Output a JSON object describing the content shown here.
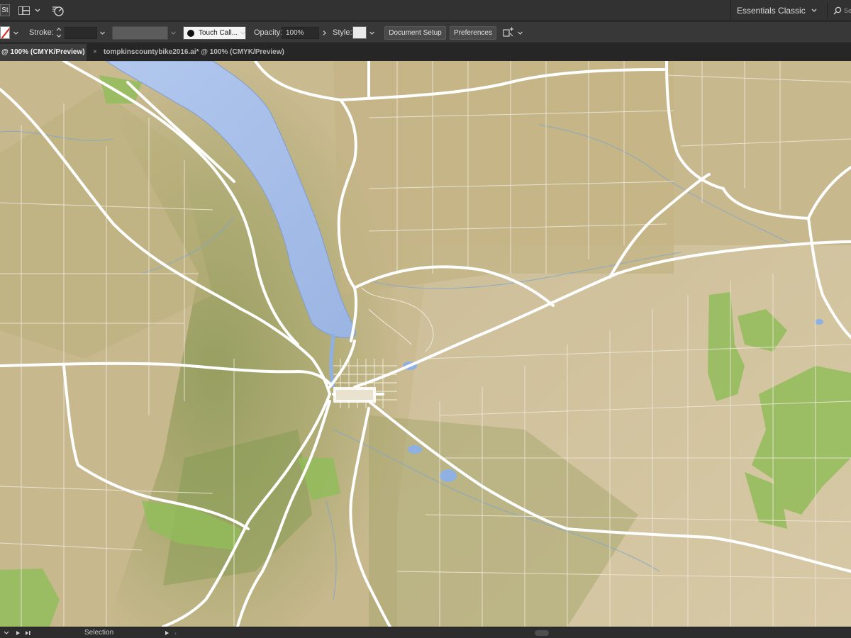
{
  "app": {
    "badge": "St",
    "workspace": "Essentials Classic",
    "search_hint": "Se"
  },
  "control_bar": {
    "stroke_label": "Stroke:",
    "stroke_value": "",
    "brush_label": "Touch Call...",
    "opacity_label": "Opacity:",
    "opacity_value": "100%",
    "style_label": "Style:",
    "document_setup_label": "Document Setup",
    "preferences_label": "Preferences"
  },
  "tabs": [
    {
      "label": "@ 100% (CMYK/Preview)",
      "active": true
    },
    {
      "label": "tompkinscountybike2016.ai* @ 100% (CMYK/Preview)",
      "active": false,
      "close": "×"
    }
  ],
  "status_bar": {
    "tool": "Selection"
  },
  "colors": {
    "lake": "#a7bee8",
    "terrain_light": "#d9cba5",
    "terrain_green": "#8ea25a",
    "forest": "#8fbf5a",
    "road_major": "#ffffff",
    "road_minor": "#ece6d5"
  },
  "icons": {
    "layout": "layout-grid-icon",
    "gpu": "gpu-performance-icon",
    "search": "search-icon",
    "fill": "fill-swatch-none-icon",
    "arrange": "arrange-documents-icon"
  }
}
